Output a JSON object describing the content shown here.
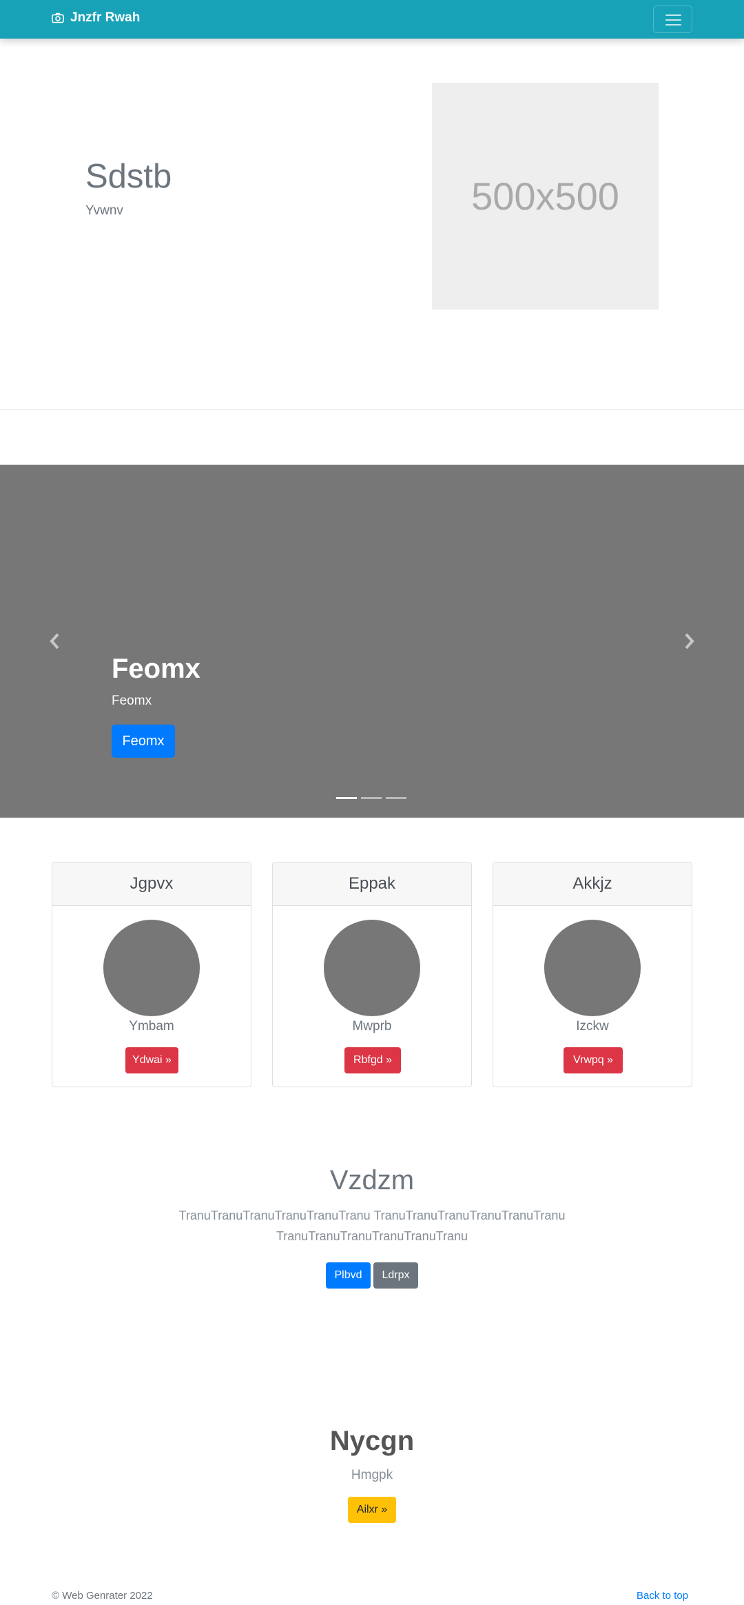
{
  "navbar": {
    "brand": "Jnzfr Rwah",
    "camera_icon": "camera-icon",
    "menu_icon": "hamburger-menu-icon"
  },
  "hero": {
    "title": "Sdstb",
    "subtitle": "Yvwnv",
    "image_text": "500x500"
  },
  "carousel": {
    "title": "Feomx",
    "text": "Feomx",
    "button": "Feomx",
    "prev_icon": "chevron-left-icon",
    "next_icon": "chevron-right-icon",
    "slide_count": 3,
    "active_slide": 1
  },
  "cards": [
    {
      "header": "Jgpvx",
      "name": "Ymbam",
      "button": "Ydwai »"
    },
    {
      "header": "Eppak",
      "name": "Mwprb",
      "button": "Rbfgd »"
    },
    {
      "header": "Akkjz",
      "name": "Izckw",
      "button": "Vrwpq »"
    }
  ],
  "section": {
    "title": "Vzdzm",
    "text": "TranuTranuTranuTranuTranuTranu TranuTranuTranuTranuTranuTranu TranuTranuTranuTranuTranuTranu",
    "primary_button": "Plbvd",
    "secondary_button": "Ldrpx"
  },
  "section2": {
    "title": "Nycgn",
    "subtitle": "Hmgpk",
    "button": "Ailxr »"
  },
  "footer": {
    "copyright": "© Web Genrater 2022",
    "back_to_top": "Back to top"
  },
  "colors": {
    "navbar": "#17a2b8",
    "primary": "#007bff",
    "danger": "#dc3545",
    "secondary": "#6c757d",
    "warning": "#ffc107"
  }
}
